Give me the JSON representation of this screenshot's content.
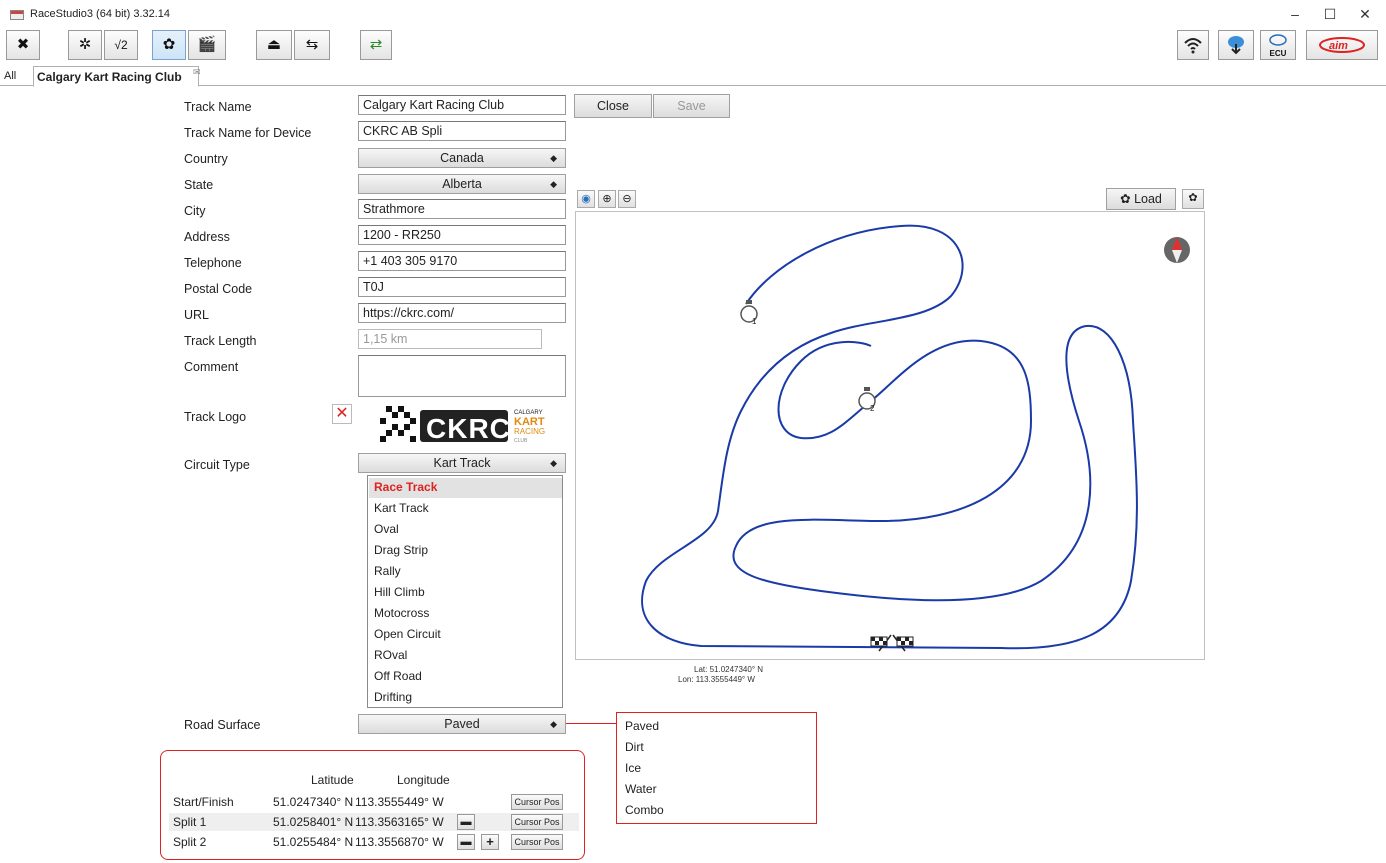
{
  "window": {
    "title": "RaceStudio3 (64 bit) 3.32.14"
  },
  "tabs": {
    "all": "All",
    "current": "Calgary Kart Racing Club"
  },
  "form": {
    "track_name_label": "Track Name",
    "track_name_value": "Calgary Kart Racing Club",
    "device_name_label": "Track Name for Device",
    "device_name_value": "CKRC AB Spli",
    "country_label": "Country",
    "country_value": "Canada",
    "state_label": "State",
    "state_value": "Alberta",
    "city_label": "City",
    "city_value": "Strathmore",
    "address_label": "Address",
    "address_value": "1200 - RR250",
    "telephone_label": "Telephone",
    "telephone_value": "+1 403 305 9170",
    "postal_label": "Postal Code",
    "postal_value": "T0J",
    "url_label": "URL",
    "url_value": "https://ckrc.com/",
    "length_label": "Track Length",
    "length_value": "1,15 km",
    "comment_label": "Comment",
    "comment_value": "",
    "logo_label": "Track Logo",
    "logo_text": "CKRC",
    "logo_small": [
      "CALGARY",
      "KART",
      "RACING",
      "CLUB"
    ],
    "circuit_label": "Circuit Type",
    "circuit_value": "Kart Track",
    "surface_label": "Road Surface",
    "surface_value": "Paved",
    "close_label": "Close",
    "save_label": "Save"
  },
  "circuit_options": [
    "Race Track",
    "Kart Track",
    "Oval",
    "Drag Strip",
    "Rally",
    "Hill Climb",
    "Motocross",
    "Open Circuit",
    "ROval",
    "Off Road",
    "Drifting"
  ],
  "surface_options": [
    "Paved",
    "Dirt",
    "Ice",
    "Water",
    "Combo"
  ],
  "map": {
    "load_label": "Load",
    "lat": "Lat: 51.0247340° N",
    "lon": "Lon: 113.3555449° W",
    "split1_marker": "1",
    "split2_marker": "2"
  },
  "coords": {
    "lat_header": "Latitude",
    "lon_header": "Longitude",
    "cursor_label": "Cursor Pos",
    "rows": [
      {
        "name": "Start/Finish",
        "lat": "51.0247340° N",
        "lon": "113.3555449° W"
      },
      {
        "name": "Split 1",
        "lat": "51.0258401° N",
        "lon": "113.3563165° W"
      },
      {
        "name": "Split 2",
        "lat": "51.0255484° N",
        "lon": "113.3556870° W"
      }
    ]
  },
  "colors": {
    "accent_red": "#dd2222",
    "track_blue": "#1a3aa8"
  },
  "icons": [
    "tools-icon",
    "gear-icon",
    "math-channel-icon",
    "track-icon",
    "clapperboard-icon",
    "data-download-icon",
    "connection-icon",
    "transfer-icon",
    "wifi-icon",
    "cloud-download-icon",
    "ecu-cloud-icon",
    "aim-logo"
  ]
}
